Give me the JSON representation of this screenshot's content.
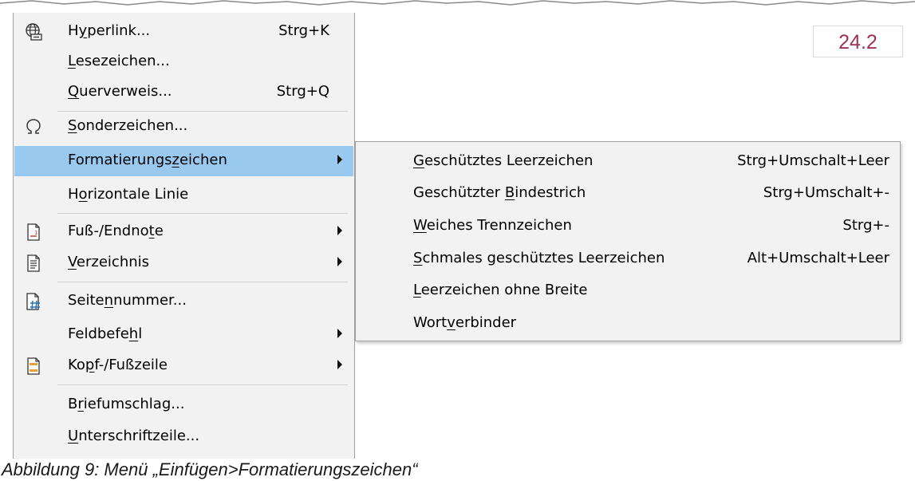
{
  "version_label": "24.2",
  "caption": "Abbildung 9: Menü „Einfügen>Formatierungszeichen“",
  "main_menu": {
    "hyperlink": {
      "pre": "H",
      "ul": "y",
      "post": "perlink...",
      "shortcut": "Strg+K"
    },
    "bookmark": {
      "pre": "",
      "ul": "L",
      "post": "esezeichen..."
    },
    "cross_reference": {
      "pre": "",
      "ul": "Q",
      "post": "uerverweis...",
      "shortcut": "Strg+Q"
    },
    "special_character": {
      "pre": "",
      "ul": "S",
      "post": "onderzeichen..."
    },
    "formatting_mark": {
      "pre": "Formatierungs",
      "ul": "z",
      "post": "eichen"
    },
    "horizontal_line": {
      "pre": "H",
      "ul": "o",
      "post": "rizontale Linie"
    },
    "footnote": {
      "pre": "Fuß-/Endno",
      "ul": "t",
      "post": "e"
    },
    "index": {
      "pre": "",
      "ul": "V",
      "post": "erzeichnis"
    },
    "page_number": {
      "pre": "Seite",
      "ul": "n",
      "post": "nummer..."
    },
    "field": {
      "pre": "Feldbefe",
      "ul": "h",
      "post": "l"
    },
    "header_footer": {
      "pre": "Ko",
      "ul": "p",
      "post": "f-/Fußzeile"
    },
    "envelope": {
      "pre": "B",
      "ul": "r",
      "post": "iefumschlag..."
    },
    "signature_line": {
      "pre": "",
      "ul": "U",
      "post": "nterschriftzeile..."
    }
  },
  "submenu": {
    "nbsp": {
      "pre": "",
      "ul": "G",
      "post": "eschütztes Leerzeichen",
      "shortcut": "Strg+Umschalt+Leer"
    },
    "nb_hyphen": {
      "pre": "Geschützter ",
      "ul": "B",
      "post": "indestrich",
      "shortcut": "Strg+Umschalt+-"
    },
    "soft_hyphen": {
      "pre": "",
      "ul": "W",
      "post": "eiches Trennzeichen",
      "shortcut": "Strg+-"
    },
    "narrow_nbsp": {
      "pre": "",
      "ul": "S",
      "post": "chmales geschütztes Leerzeichen",
      "shortcut": "Alt+Umschalt+Leer"
    },
    "zero_width_space": {
      "pre": "",
      "ul": "L",
      "post": "eerzeichen ohne Breite"
    },
    "word_joiner": {
      "pre": "Wort",
      "ul": "v",
      "post": "erbinder"
    }
  },
  "icons": {
    "hyperlink": "globe-link-icon",
    "special_character": "omega-icon",
    "footnote": "footnote-doc-icon",
    "index": "index-doc-icon",
    "page_number": "page-number-icon",
    "header_footer": "header-footer-icon"
  },
  "colors": {
    "highlight": "#99c9ef",
    "menu_bg": "#f2f2f2",
    "version_text": "#a0325a"
  }
}
